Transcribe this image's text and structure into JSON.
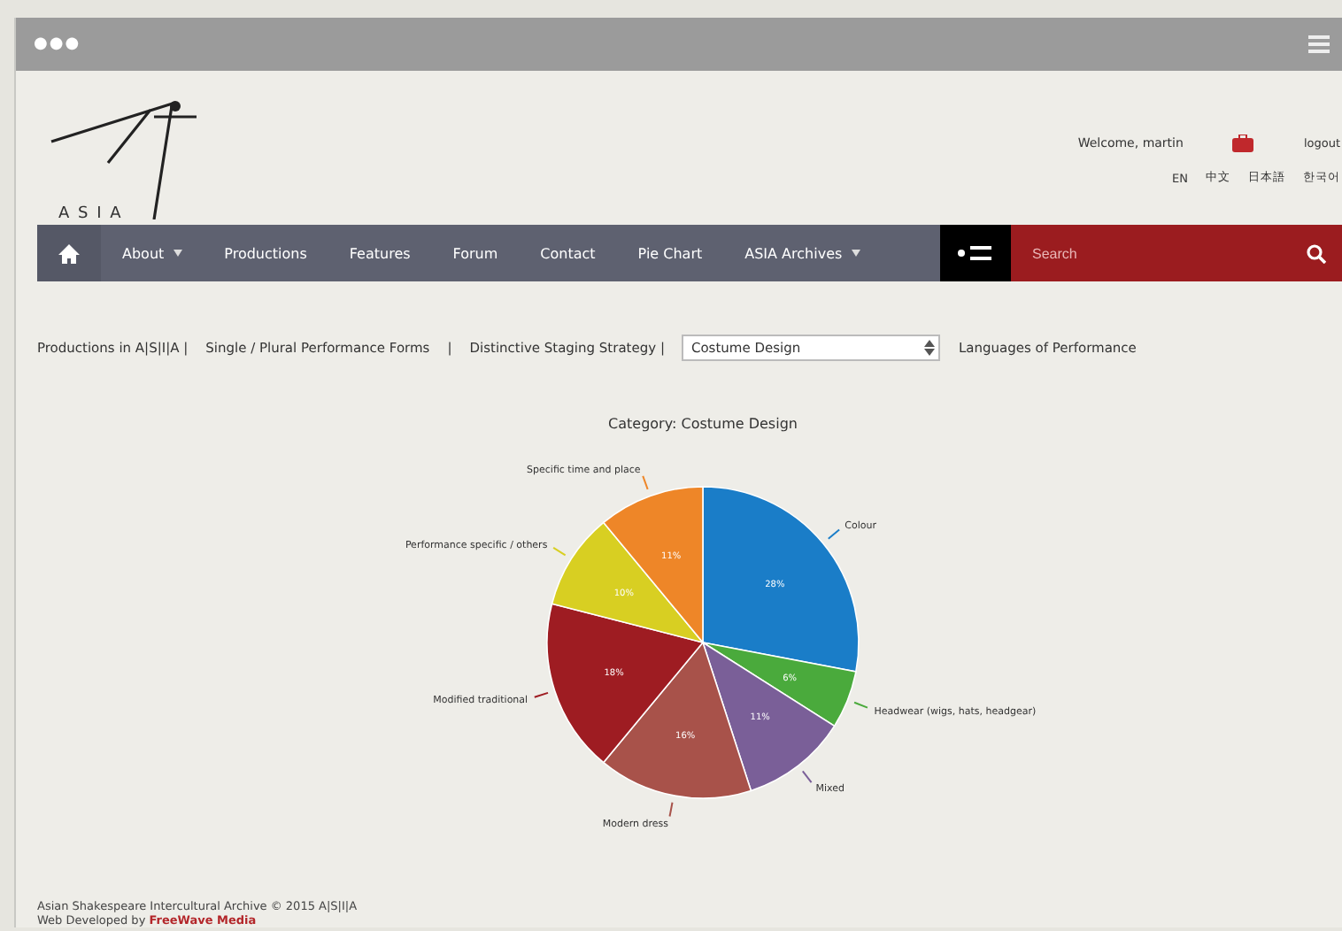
{
  "window": {
    "dots": "●●●"
  },
  "header": {
    "logo_text": "A S I A",
    "welcome": "Welcome, martin",
    "logout": "logout",
    "languages": [
      "EN",
      "中文",
      "日本語",
      "한국어"
    ]
  },
  "nav": {
    "items": [
      {
        "label": "About",
        "dropdown": true
      },
      {
        "label": "Productions",
        "dropdown": false
      },
      {
        "label": "Features",
        "dropdown": false
      },
      {
        "label": "Forum",
        "dropdown": false
      },
      {
        "label": "Contact",
        "dropdown": false
      },
      {
        "label": "Pie Chart",
        "dropdown": false
      },
      {
        "label": "ASIA Archives",
        "dropdown": true
      }
    ],
    "search": {
      "placeholder": "Search"
    }
  },
  "filters": {
    "links": [
      "Productions in A|S|I|A |",
      "Single / Plural Performance Forms",
      "|",
      "Distinctive Staging Strategy |"
    ],
    "select": {
      "value": "Costume Design"
    },
    "after": "Languages of Performance"
  },
  "chart": {
    "chart_data": {
      "type": "pie",
      "title": "Category: Costume Design",
      "categories": [
        "Colour",
        "Headwear (wigs, hats, headgear)",
        "Mixed",
        "Modern dress",
        "Modified traditional",
        "Performance specific / others",
        "Specific time and place"
      ],
      "series": [
        {
          "colors": [
            "#1a7dc8",
            "#4aaa3c",
            "#7a5f98",
            "#a8524a",
            "#9e1c22",
            "#d8cf22",
            "#ee8628"
          ],
          "values": [
            28,
            6,
            11,
            16,
            18,
            10,
            11
          ]
        }
      ],
      "value_labels": [
        "28%",
        "6%",
        "11%",
        "16%",
        "18%",
        "10%",
        "11%"
      ]
    }
  },
  "footer": {
    "copyright": "Asian Shakespeare Intercultural Archive © 2015 A|S|I|A",
    "credit": "Web Developed by",
    "credit_link": "FreeWave Media"
  }
}
